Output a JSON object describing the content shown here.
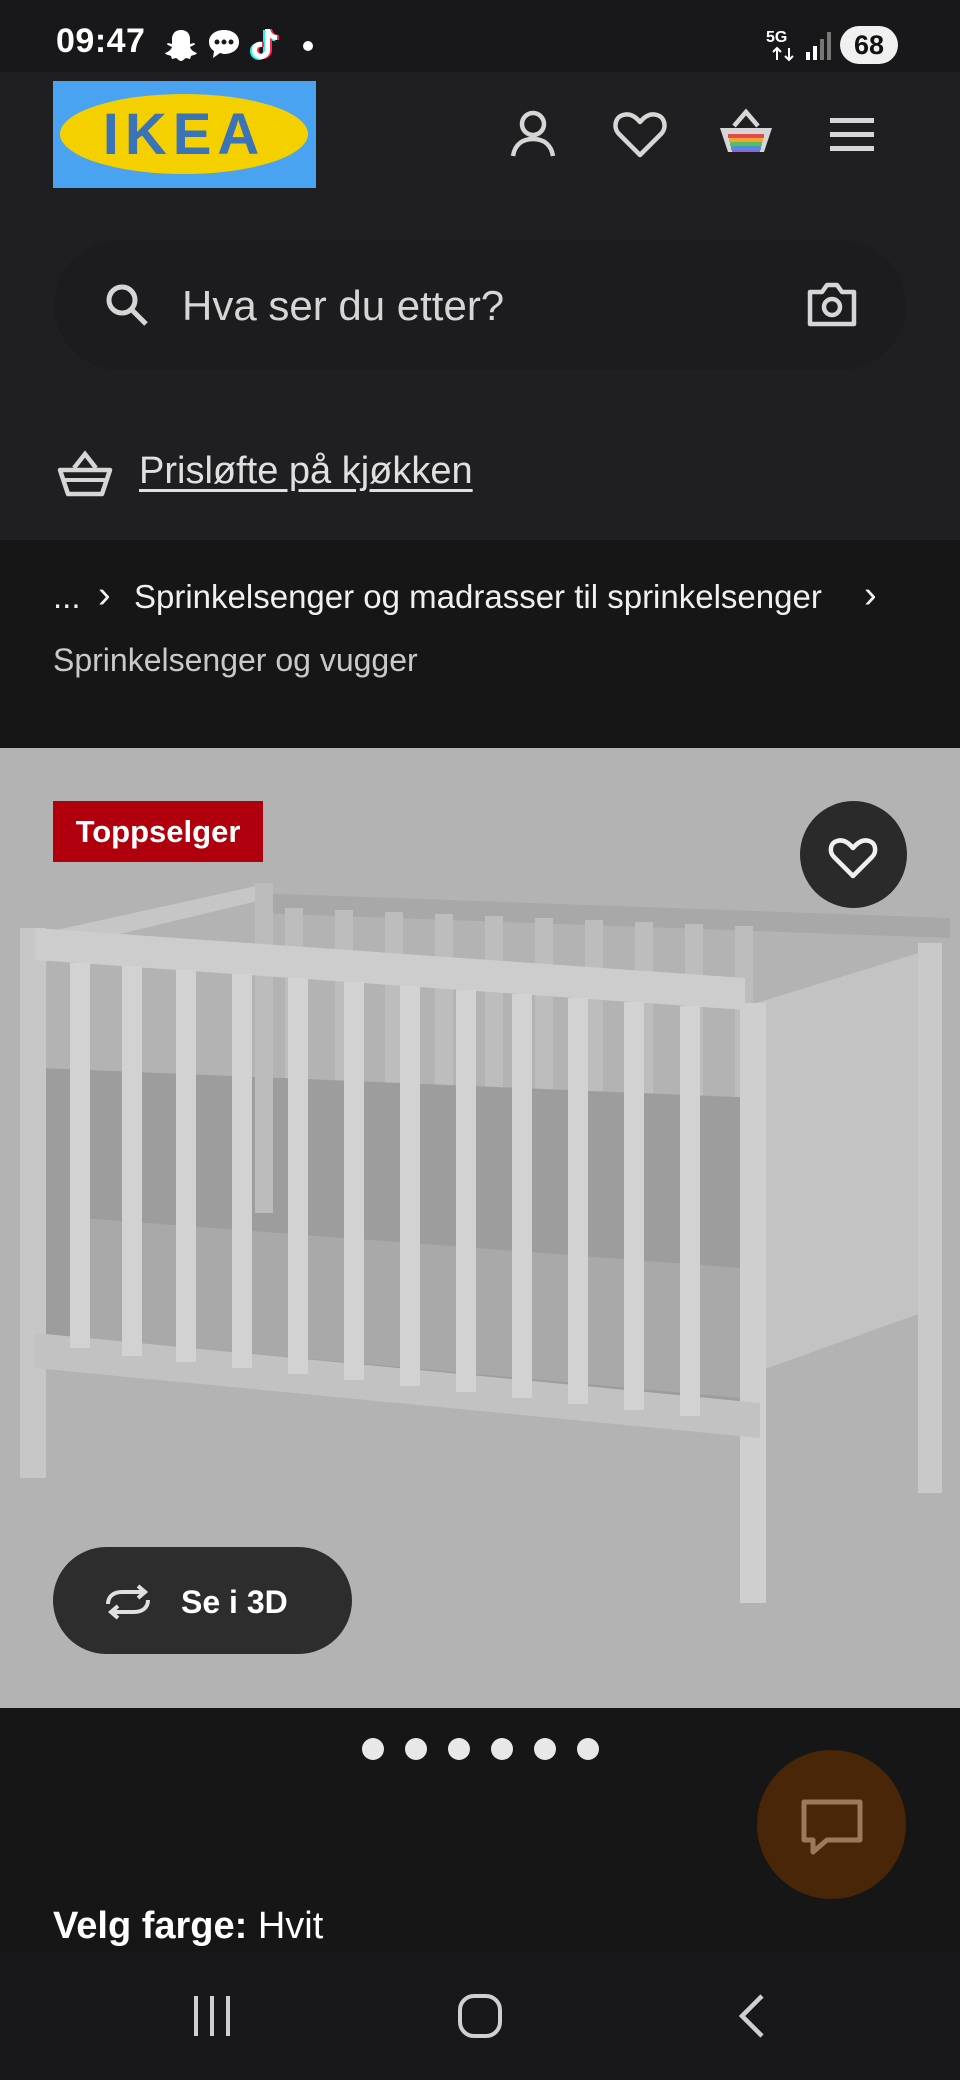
{
  "status_bar": {
    "time": "09:47",
    "network": "5G",
    "battery": "68",
    "icons": [
      "snapchat-icon",
      "messages-icon",
      "tiktok-icon",
      "dot-icon",
      "signal-icon"
    ]
  },
  "header": {
    "logo_text": "IKEA",
    "icons": [
      "account-icon",
      "heart-icon",
      "basket-icon",
      "menu-icon"
    ]
  },
  "search": {
    "placeholder": "Hva ser du etter?",
    "icons": [
      "search-icon",
      "camera-icon"
    ]
  },
  "promo": {
    "text": "Prisløfte på kjøkken",
    "icon": "basket-icon"
  },
  "breadcrumb": {
    "ellipsis": "...",
    "separator": "›",
    "parent": "Sprinkelsenger og madrasser til sprinkelsenger",
    "current": "Sprinkelsenger og vugger"
  },
  "product": {
    "badge": "Toppselger",
    "view_3d_label": "Se i 3D",
    "carousel_pages": 6,
    "color_label": "Velg farge:",
    "color_value": "Hvit"
  },
  "colors": {
    "badge_red": "#b0000d",
    "ikea_blue": "#4aa3f0",
    "ikea_yellow": "#f4d000",
    "chat_brown": "#4a2608"
  }
}
